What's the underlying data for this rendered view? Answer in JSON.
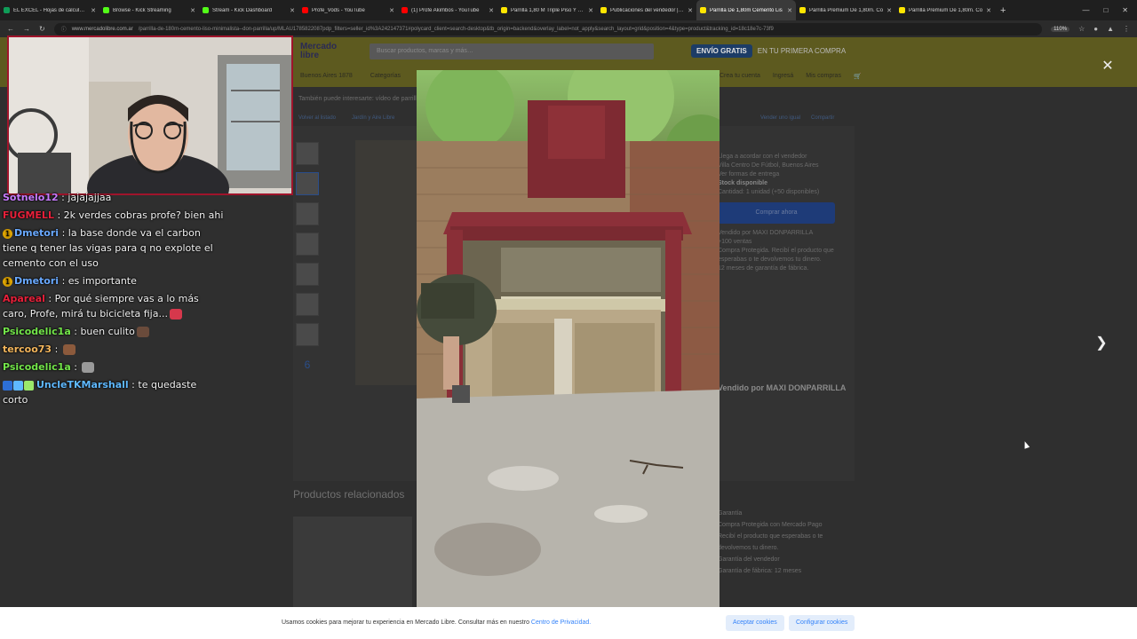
{
  "browser": {
    "tabs": [
      {
        "label": "EL EXCEL - Hojas de cálculo de",
        "color": "#0f9d58"
      },
      {
        "label": "Browse - Kick Streaming",
        "color": "#53fc18"
      },
      {
        "label": "Stream - Kick Dashboard",
        "color": "#53fc18"
      },
      {
        "label": "Profe_Vods - YouTube",
        "color": "#ff0000"
      },
      {
        "label": "(1) Profe Akimbos - YouTube",
        "color": "#ff0000"
      },
      {
        "label": "Parrilla 1,80 M Triple Piso Y Pue",
        "color": "#ffe600"
      },
      {
        "label": "Publicaciones del vendedor | M",
        "color": "#ffe600"
      },
      {
        "label": "Parrilla De 1,80m Cemento Lis",
        "color": "#ffe600"
      },
      {
        "label": "Parrilla Premium De 1,80m. Co",
        "color": "#ffe600"
      },
      {
        "label": "Parrilla Premium De 1,80m. Co",
        "color": "#ffe600"
      }
    ],
    "active_tab_index": 7,
    "url_host": "www.mercadolibre.com.ar",
    "url_path": "/parrilla-de-180m-cemento-liso-minimalista--don-parrilla/up/MLAU1785822087pdp_filters=seller_id%3A242147371#polycard_client=search-desktop&tb_origin=backend&overlay_label=not_apply&search_layout=grid&position=4&type=product&tracking_id=18c18e7c-73f9",
    "zoom": "110%"
  },
  "ml": {
    "logo_line1": "Mercado",
    "logo_line2": "libre",
    "search_placeholder": "Buscar productos, marcas y más…",
    "promo_pill": "ENVÍO GRATIS",
    "promo_text": "EN TU PRIMERA COMPRA",
    "location": "Buenos Aires 1878",
    "nav_categories": "Categorías",
    "nav_right": [
      "Crea tu cuenta",
      "Ingresá",
      "Mis compras"
    ],
    "also_interested": "También puede interesarte: vídeo de parrilla",
    "crumbs": [
      "Volver al listado",
      "Jardín y Aire Libre"
    ],
    "crumbs_right": [
      "Vender uno igual",
      "Compartir"
    ],
    "thumb_more": "6",
    "side_lines": [
      "Llega a acordar con el vendedor",
      "Villa Centro De Fútbol, Buenos Aires",
      "Ver formas de entrega",
      "",
      "Stock disponible",
      "Cantidad: 1 unidad  (+50 disponibles)"
    ],
    "buy_label": "Comprar ahora",
    "side_lines2": [
      "Vendido por MAXI DONPARRILLA",
      "+100 ventas",
      "",
      "Compra Protegida. Recibí el producto que esperabas o te devolvemos tu dinero.",
      "",
      "12 meses de garantía de fábrica."
    ],
    "seller_title": "Vendido por MAXI DONPARRILLA",
    "related_title": "Productos relacionados",
    "garantia_lines": [
      "Garantía",
      "Compra Protegida con Mercado Pago",
      "Recibí el producto que esperabas o te devolvemos tu dinero.",
      "Garantía del vendedor",
      "Garantía de fábrica: 12 meses"
    ]
  },
  "cookie": {
    "text": "Usamos cookies para mejorar tu experiencia en Mercado Libre. Consultar más en nuestro",
    "link": "Centro de Privacidad.",
    "accept": "Aceptar cookies",
    "configure": "Configurar cookies"
  },
  "chat": [
    {
      "user": "Sotnelo12",
      "user_color": "#c87cff",
      "text": "jajajajjaa"
    },
    {
      "user": "FUGMELL",
      "user_color": "#e8203a",
      "text": "2k verdes cobras profe? bien ahi"
    },
    {
      "user": "Dmetori",
      "user_color": "#69a9ff",
      "badge": "1",
      "text": "la base donde va el carbon tiene q tener las vigas para q no explote el cemento con el uso"
    },
    {
      "user": "Dmetori",
      "user_color": "#69a9ff",
      "badge": "1",
      "text": "es importante"
    },
    {
      "user": "Apareal",
      "user_color": "#e8203a",
      "text": "Por qué siempre vas a lo más caro, Profe, mirá tu bicicleta fija...",
      "emote": "#d6384c"
    },
    {
      "user": "Psicodelic1a",
      "user_color": "#73e54a",
      "text": "buen culito",
      "emote": "#6a4b3b"
    },
    {
      "user": "tercoo73",
      "user_color": "#f4b65c",
      "text": "",
      "emote": "#8c5a3c"
    },
    {
      "user": "Psicodelic1a",
      "user_color": "#73e54a",
      "text": "",
      "emote": "#9a9a9a"
    },
    {
      "user": "UncleTKMarshall",
      "user_color": "#5fb9ff",
      "text": "te quedaste corto",
      "sub_badges": [
        "#2d6fd6",
        "#5fb9ff",
        "#9be86a"
      ]
    }
  ]
}
